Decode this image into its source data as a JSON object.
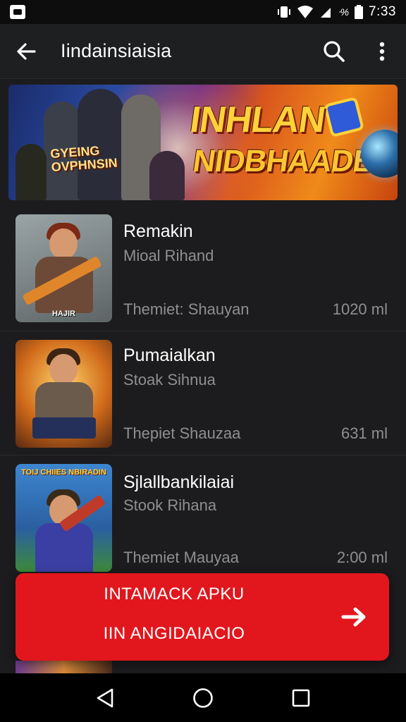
{
  "status_bar": {
    "carrier_text": "ᐧ%",
    "time": "7:33"
  },
  "app_bar": {
    "title": "Iindainsiaisia"
  },
  "banner": {
    "heading": "INHLAN",
    "subheading": "NIDBHAADBA?",
    "logo_line1": "GYEING",
    "logo_line2": "OVPHNSIN"
  },
  "list": [
    {
      "title": "Remakin",
      "subtitle": "Mioal Rihand",
      "meta": "Themiet: Shauyan",
      "size": "1020 ml",
      "thumb_caption": "HAJIR",
      "thumb_bg": "#7d8a8c",
      "thumb_hair": "#7b2a16",
      "thumb_body": "#6d4a37",
      "thumb_weapon": "#e0862a"
    },
    {
      "title": "Pumaialkan",
      "subtitle": "Stoak Sihnua",
      "meta": "Thepiet Shauzaa",
      "size": "631 ml",
      "thumb_caption": "",
      "thumb_bg": "#c9701f",
      "thumb_hair": "#3b2414",
      "thumb_body": "#6a5b4c",
      "thumb_weapon": "#4b3a2a"
    },
    {
      "title": "Sjlallbankilaiai",
      "subtitle": "Stook Rihana",
      "meta": "Themiet Mauyaa",
      "size": "2:00 ml",
      "thumb_caption": "TOIJ CHIIES NBIRADIN",
      "thumb_bg": "#2f6fb3",
      "thumb_hair": "#3a2a1a",
      "thumb_body": "#3b3fa4",
      "thumb_weapon": "#c03a2a"
    }
  ],
  "install_button": {
    "line1": "INTAMACK APKU",
    "line2": "IIN ANGIDAIACIO"
  }
}
